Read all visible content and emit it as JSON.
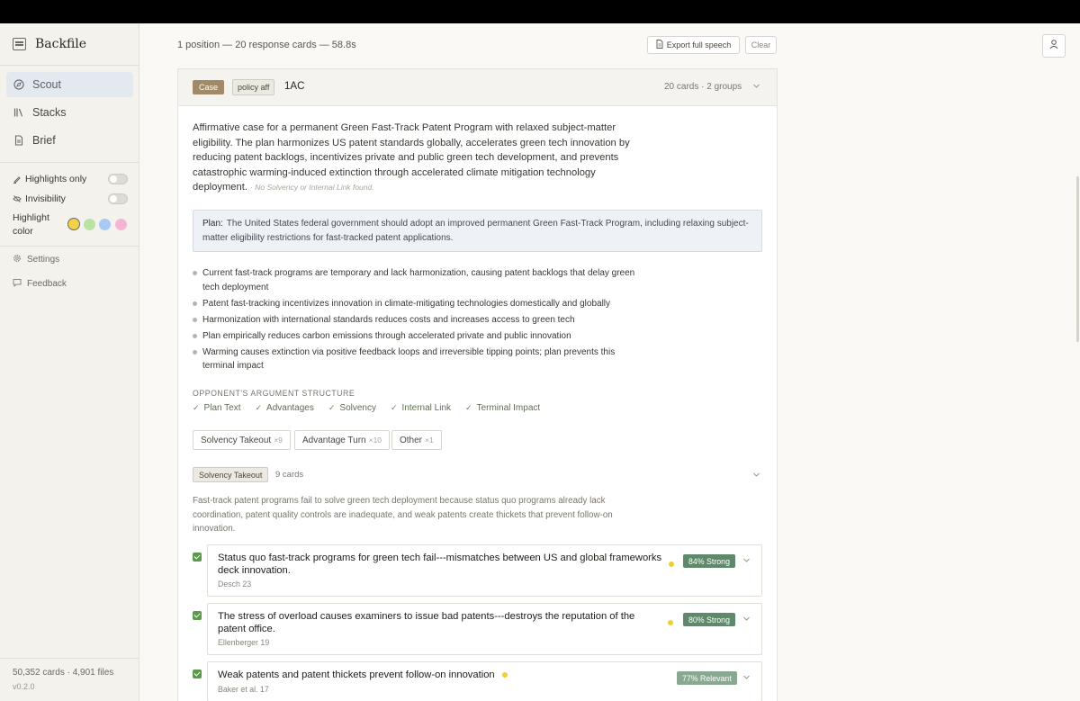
{
  "app": {
    "name": "Backfile",
    "version": "v0.2.0",
    "stats": "50,352 cards · 4,901 files"
  },
  "sidebar": {
    "nav": [
      {
        "label": "Scout",
        "icon": "compass-icon"
      },
      {
        "label": "Stacks",
        "icon": "library-icon"
      },
      {
        "label": "Brief",
        "icon": "document-icon"
      }
    ],
    "toggles": [
      {
        "label": "Highlights only",
        "icon": "highlighter-icon"
      },
      {
        "label": "Invisibility",
        "icon": "eye-off-icon"
      }
    ],
    "highlight_label": "Highlight color",
    "highlight_colors": [
      "#f2d24b",
      "#b9e2a6",
      "#a9c8f2",
      "#f4b4d3"
    ],
    "settings_label": "Settings",
    "feedback_label": "Feedback"
  },
  "header": {
    "summary": "1 position — 20 response cards — 58.8s",
    "export_label": "Export full speech",
    "clear_label": "Clear"
  },
  "case": {
    "tag": "Case",
    "type": "policy aff",
    "name": "1AC",
    "count": "20 cards · 2 groups",
    "description": "Affirmative case for a permanent Green Fast-Track Patent Program with relaxed subject-matter eligibility. The plan harmonizes US patent standards globally, accelerates green tech innovation by reducing patent backlogs, incentivizes private and public green tech development, and prevents catastrophic warming-induced extinction through accelerated climate mitigation technology deployment.",
    "description_note": "· No Solvency or Internal Link found.",
    "plan_label": "Plan:",
    "plan_text": "The United States federal government should adopt an improved permanent Green Fast-Track Program, including relaxing subject-matter eligibility restrictions for fast-tracked patent applications.",
    "points": [
      "Current fast-track programs are temporary and lack harmonization, causing patent backlogs that delay green tech deployment",
      "Patent fast-tracking incentivizes innovation in climate-mitigating technologies domestically and globally",
      "Harmonization with international standards reduces costs and increases access to green tech",
      "Plan empirically reduces carbon emissions through accelerated private and public innovation",
      "Warming causes extinction via positive feedback loops and irreversible tipping points; plan prevents this terminal impact"
    ],
    "structure_label": "OPPONENT'S ARGUMENT STRUCTURE",
    "structure": [
      "Plan Text",
      "Advantages",
      "Solvency",
      "Internal Link",
      "Terminal Impact"
    ]
  },
  "filters": [
    {
      "label": "Solvency Takeout",
      "count": "×9"
    },
    {
      "label": "Advantage Turn",
      "count": "×10"
    },
    {
      "label": "Other",
      "count": "×1"
    }
  ],
  "group": {
    "label": "Solvency Takeout",
    "count": "9 cards",
    "description": "Fast-track patent programs fail to solve green tech deployment because status quo programs already lack coordination, patent quality controls are inadequate, and weak patents create thickets that prevent follow-on innovation."
  },
  "cards": [
    {
      "title": "Status quo fast-track programs for green tech fail---mismatches between US and global frameworks deck innovation.",
      "cite": "Desch 23",
      "tag": "84% Strong",
      "tag_color": "#5e8a6b"
    },
    {
      "title": "The stress of overload causes examiners to issue bad patents---destroys the reputation of the patent office.",
      "cite": "Ellenberger 19",
      "tag": "80% Strong",
      "tag_color": "#5e8a6b"
    },
    {
      "title": "Weak patents and patent thickets prevent follow-on innovation",
      "cite": "Baker et al. 17",
      "tag": "77% Relevant",
      "tag_color": "#89a892"
    }
  ]
}
